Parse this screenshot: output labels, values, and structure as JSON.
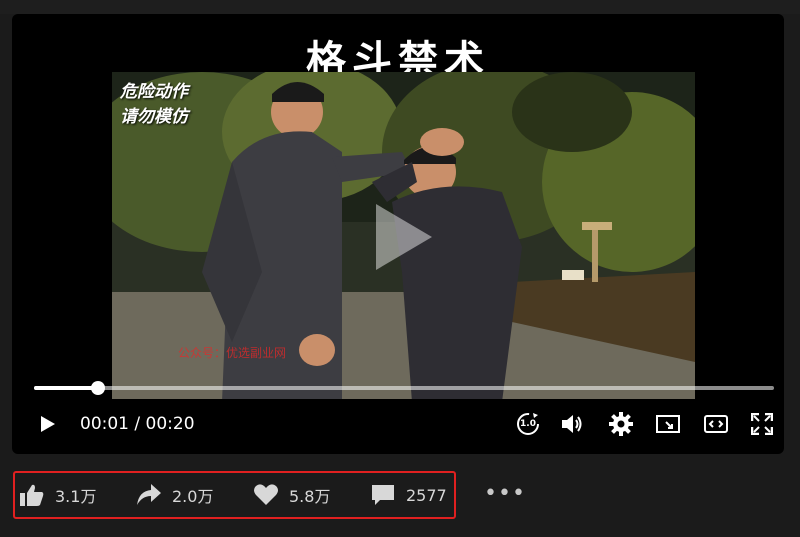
{
  "video": {
    "title": "格斗禁术",
    "corner_caption_line1": "危险动作",
    "corner_caption_line2": "请勿模仿",
    "watermark": "公众号：优选副业网",
    "progress_fraction": 0.086,
    "time_display": "00:01 / 00:20",
    "speed_label": "1.0"
  },
  "controls": {
    "play_icon": "play-icon",
    "speed_icon": "playback-speed-icon",
    "volume_icon": "volume-icon",
    "settings_icon": "gear-icon",
    "pip_icon": "picture-in-picture-icon",
    "theater_icon": "theater-mode-icon",
    "fullscreen_icon": "fullscreen-icon"
  },
  "actions": {
    "like_count": "3.1万",
    "share_count": "2.0万",
    "favorite_count": "5.8万",
    "comment_count": "2577",
    "more_label": "•••"
  },
  "colors": {
    "highlight_border": "#e02020",
    "page_background": "#1b1b1b"
  }
}
